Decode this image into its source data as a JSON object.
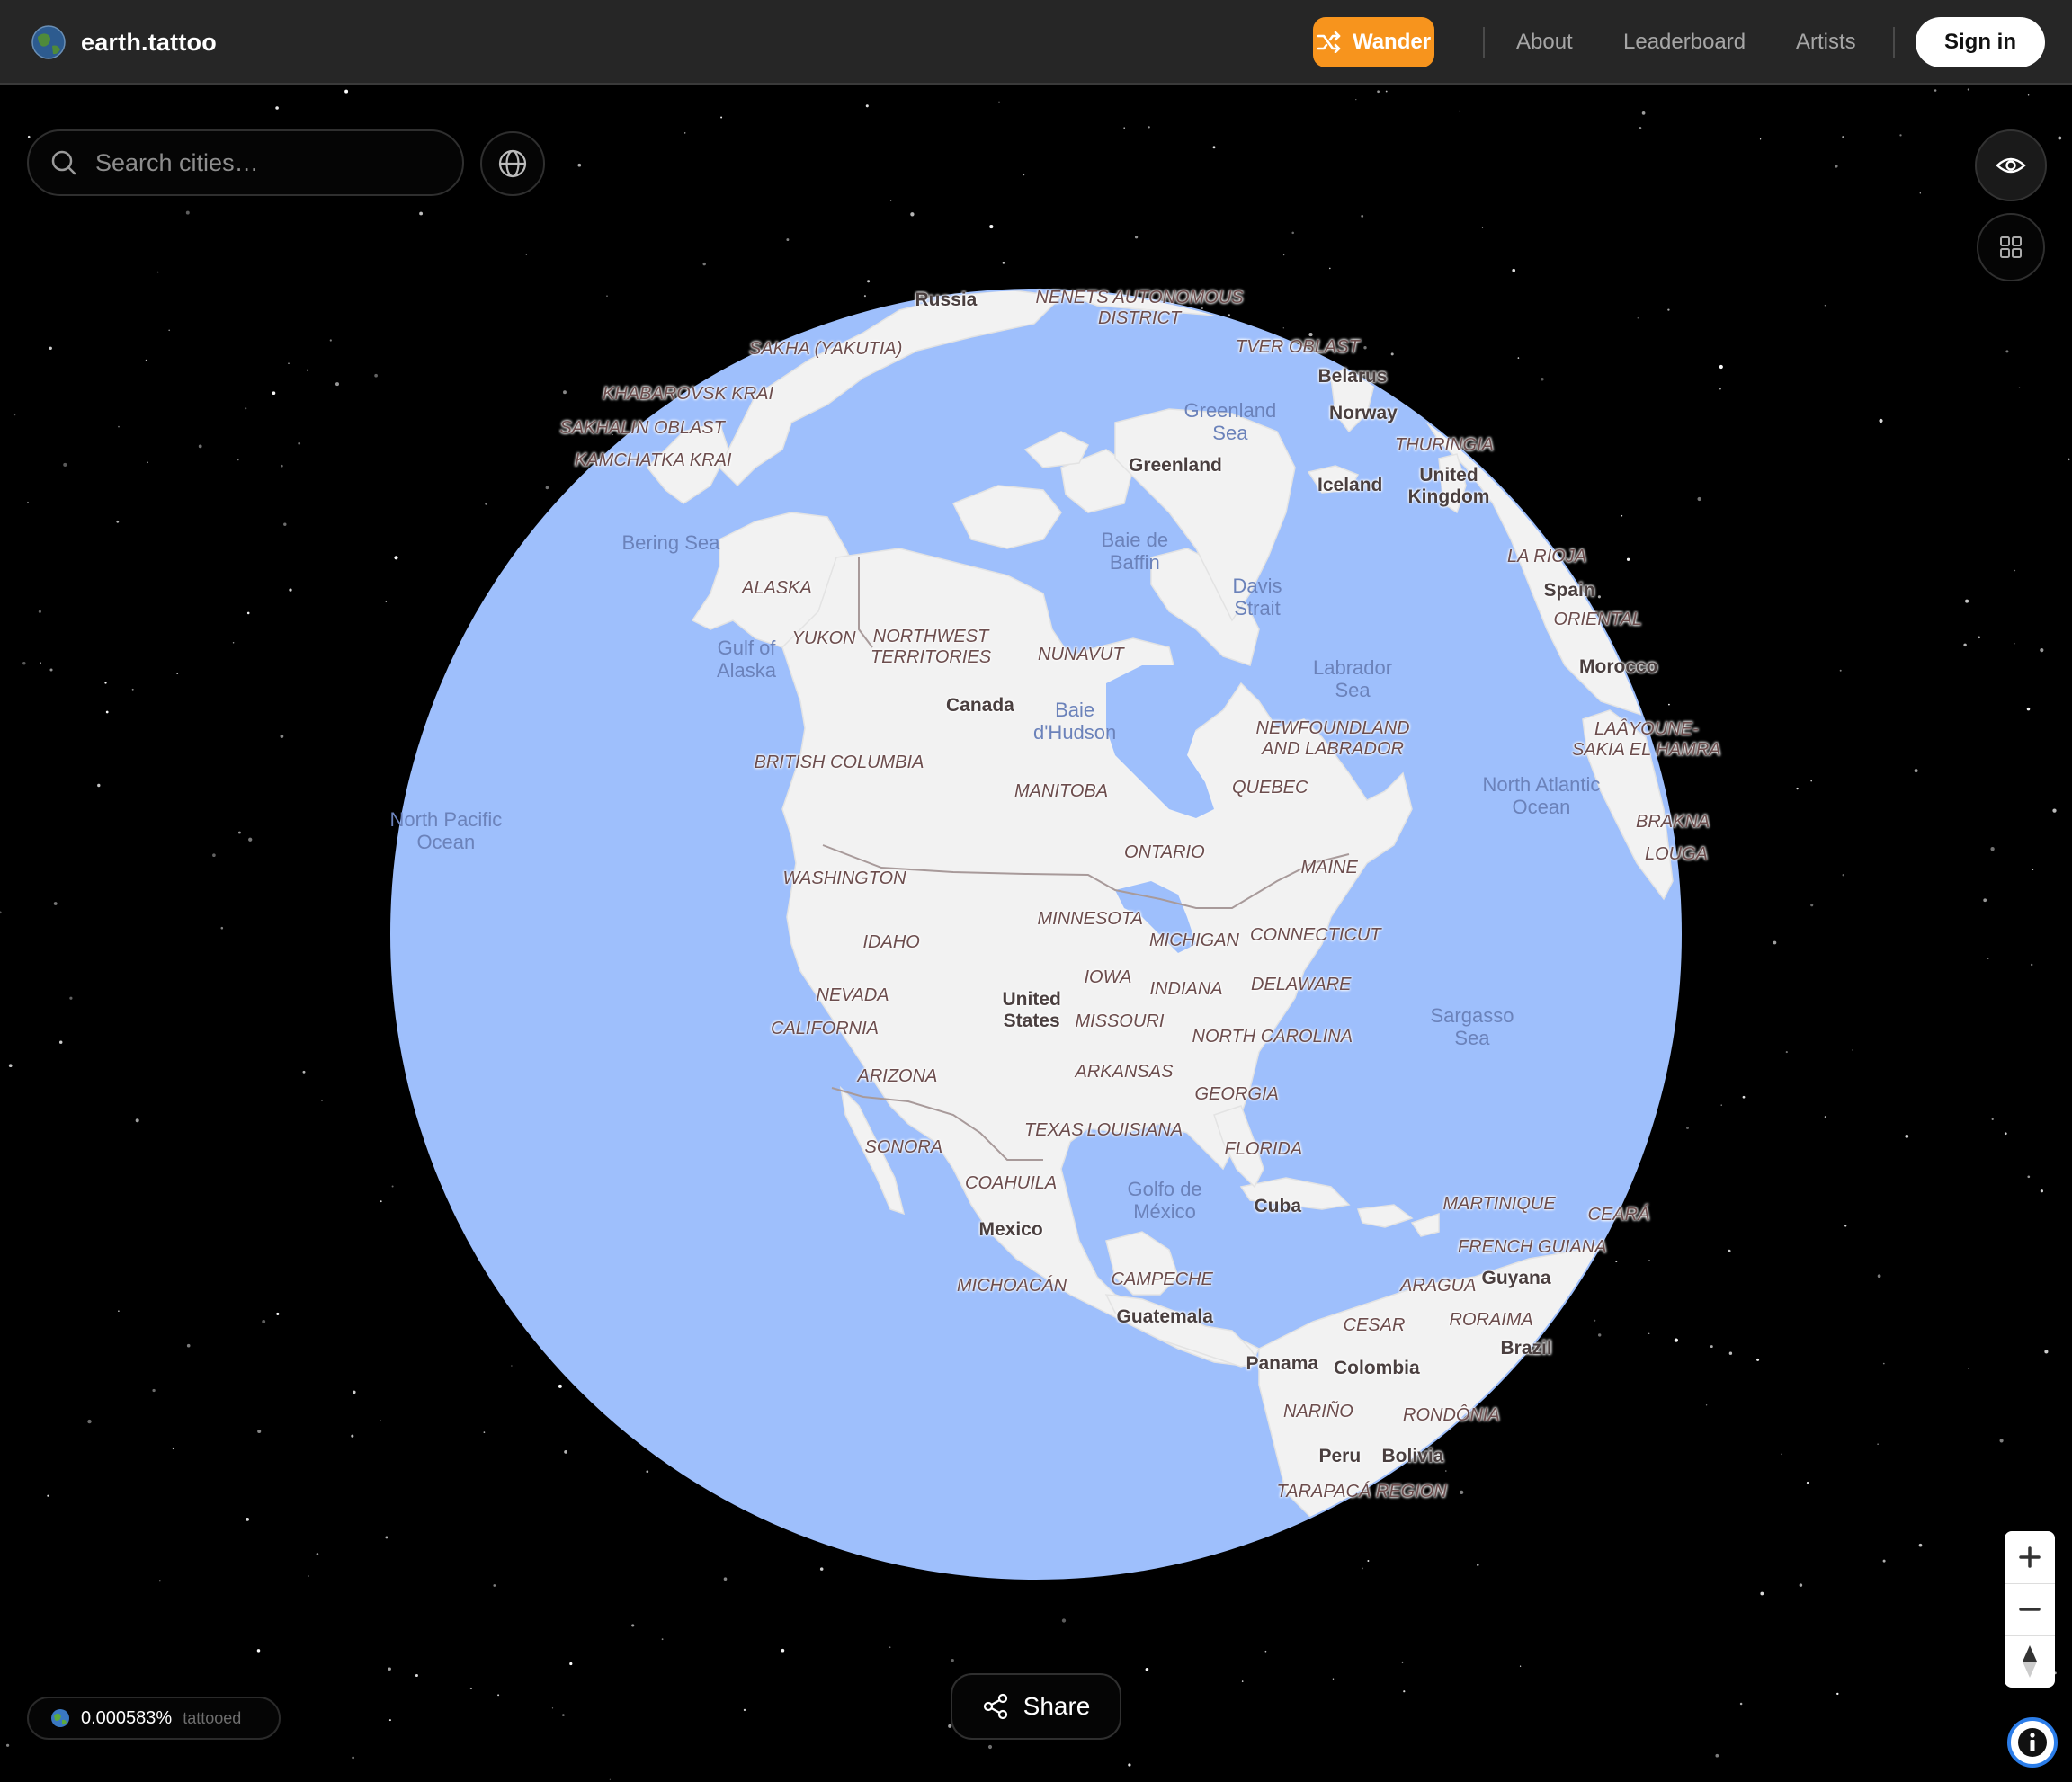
{
  "app": {
    "name": "earth.tattoo",
    "logo_icon": "earth-globe-icon"
  },
  "nav": {
    "wander_label": "Wander",
    "about_label": "About",
    "leaderboard_label": "Leaderboard",
    "artists_label": "Artists",
    "signin_label": "Sign in",
    "wander_color": "#f7941d"
  },
  "search": {
    "placeholder": "Search cities…"
  },
  "controls": {
    "globe_toggle_icon": "globe-icon",
    "visibility_icon": "eye-icon",
    "grid_icon": "grid-icon",
    "zoom_in_icon": "plus-icon",
    "zoom_out_icon": "minus-icon",
    "compass_icon": "compass-icon",
    "info_icon": "info-icon"
  },
  "share": {
    "label": "Share"
  },
  "stats": {
    "tattooed_percent": "0.000583%",
    "tattooed_label": "tattooed"
  },
  "map": {
    "ocean_color": "#9ebffc",
    "land_color": "#f2f2f2",
    "labels": {
      "countries": [
        "Russia",
        "Belarus",
        "Norway",
        "Greenland",
        "Iceland",
        "United Kingdom",
        "Spain",
        "Morocco",
        "Canada",
        "United States",
        "Mexico",
        "Cuba",
        "Guatemala",
        "Panama",
        "Colombia",
        "Guyana",
        "Brazil",
        "Peru",
        "Bolivia"
      ],
      "regions": [
        "NENETS AUTONOMOUS DISTRICT",
        "TVER OBLAST",
        "SAKHA (YAKUTIA)",
        "KHABAROVSK KRAI",
        "SAKHALIN OBLAST",
        "KAMCHATKA KRAI",
        "THURINGIA",
        "LA RIOJA",
        "ORIENTAL",
        "LAÂYOUNE-SAKIA EL HAMRA",
        "BRAKNA",
        "LOUGA",
        "ALASKA",
        "YUKON",
        "NORTHWEST TERRITORIES",
        "NUNAVUT",
        "BRITISH COLUMBIA",
        "MANITOBA",
        "QUEBEC",
        "NEWFOUNDLAND AND LABRADOR",
        "ONTARIO",
        "MAINE",
        "WASHINGTON",
        "MINNESOTA",
        "IDAHO",
        "MICHIGAN",
        "CONNECTICUT",
        "IOWA",
        "INDIANA",
        "DELAWARE",
        "NEVADA",
        "MISSOURI",
        "CALIFORNIA",
        "NORTH CAROLINA",
        "ARIZONA",
        "ARKANSAS",
        "GEORGIA",
        "TEXAS",
        "LOUISIANA",
        "SONORA",
        "FLORIDA",
        "COAHUILA",
        "MARTINIQUE",
        "CEARÁ",
        "FRENCH GUIANA",
        "MICHOACÁN",
        "CAMPECHE",
        "ARAGUA",
        "RORAIMA",
        "CESAR",
        "NARIÑO",
        "RONDÔNIA",
        "TARAPACÁ REGION"
      ],
      "water": [
        "Greenland Sea",
        "Bering Sea",
        "Baie de Baffin",
        "Davis Strait",
        "Gulf of Alaska",
        "Labrador Sea",
        "Baie d'Hudson",
        "North Atlantic Ocean",
        "North Pacific Ocean",
        "Sargasso Sea",
        "Golfo de México"
      ]
    }
  }
}
